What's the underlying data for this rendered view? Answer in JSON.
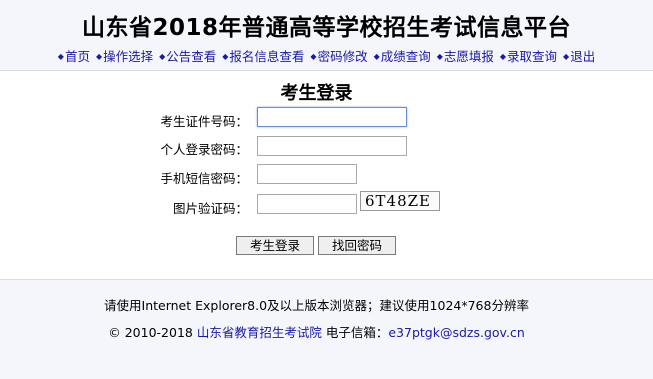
{
  "header": {
    "title": "山东省2018年普通高等学校招生考试信息平台"
  },
  "nav": {
    "items": [
      {
        "label": "首页"
      },
      {
        "label": "操作选择"
      },
      {
        "label": "公告查看"
      },
      {
        "label": "报名信息查看"
      },
      {
        "label": "密码修改"
      },
      {
        "label": "成绩查询"
      },
      {
        "label": "志愿填报"
      },
      {
        "label": "录取查询"
      },
      {
        "label": "退出"
      }
    ]
  },
  "login": {
    "title": "考生登录",
    "fields": [
      {
        "label": "考生证件号码：",
        "value": ""
      },
      {
        "label": "个人登录密码：",
        "value": ""
      },
      {
        "label": "手机短信密码：",
        "value": ""
      },
      {
        "label": "图片验证码：",
        "value": ""
      }
    ],
    "captcha_text": "6T48ZE",
    "login_button": "考生登录",
    "recover_button": "找回密码"
  },
  "footer": {
    "browser_note": "请使用Internet Explorer8.0及以上版本浏览器；建议使用1024*768分辨率",
    "copyright": "© 2010-2018",
    "org_link": "山东省教育招生考试院",
    "email_label": "电子信箱：",
    "email": "e37ptgk@sdzs.gov.cn"
  },
  "colors": {
    "link": "#1a1aa6",
    "header_bg": "#f4f6fc"
  }
}
